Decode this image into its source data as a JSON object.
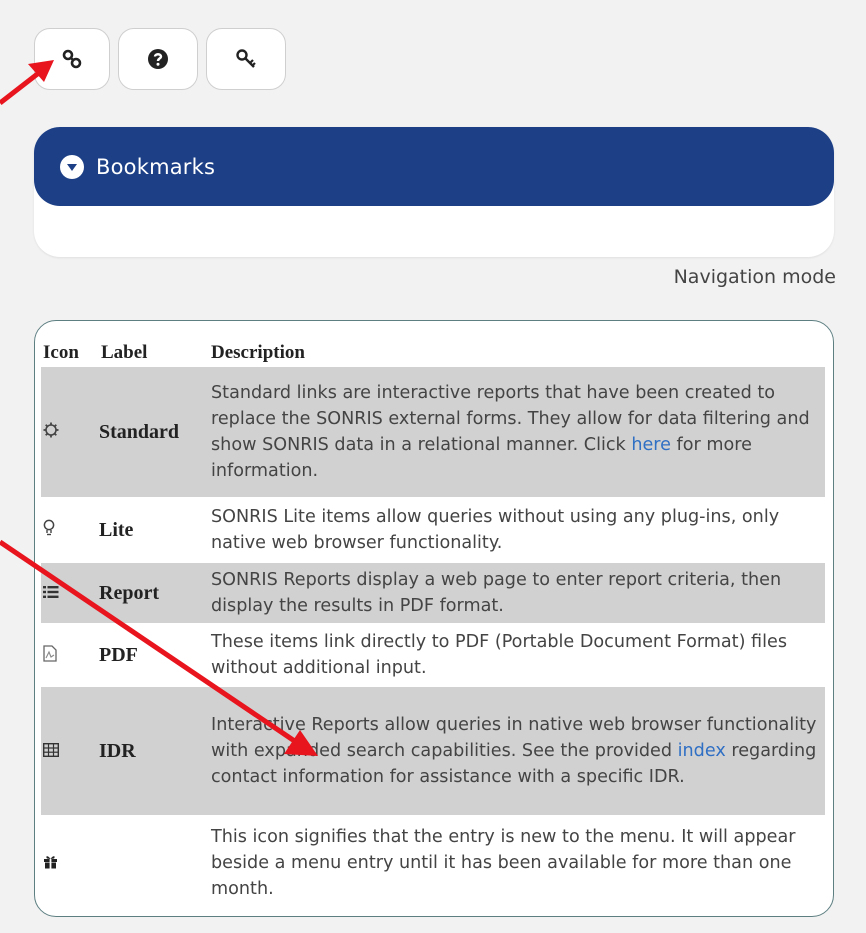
{
  "toolbar": {
    "buttons": [
      {
        "icon": "link-icon"
      },
      {
        "icon": "question-circle-icon"
      },
      {
        "icon": "key-icon"
      }
    ]
  },
  "panel": {
    "title": "Bookmarks",
    "toggle_icon": "chevron-down-circle-icon",
    "header_color": "#1c3f86"
  },
  "nav_mode_label": "Navigation mode",
  "legend": {
    "headers": {
      "icon": "Icon",
      "label": "Label",
      "description": "Description"
    },
    "rows": [
      {
        "icon": "gear-icon",
        "label": "Standard",
        "desc_before": "Standard links are interactive reports that have been created to replace the SONRIS external forms. They allow for data filtering and show SONRIS data in a relational manner. Click ",
        "link_text": "here",
        "desc_after": " for more information."
      },
      {
        "icon": "lightbulb-icon",
        "label": "Lite",
        "description": "SONRIS Lite items allow queries without using any plug-ins, only native web browser functionality."
      },
      {
        "icon": "list-icon",
        "label": "Report",
        "description": "SONRIS Reports display a web page to enter report criteria, then display the results in PDF format."
      },
      {
        "icon": "pdf-file-icon",
        "label": "PDF",
        "description": "These items link directly to PDF (Portable Document Format) files without additional input."
      },
      {
        "icon": "table-icon",
        "label": "IDR",
        "desc_before": "Interactive Reports allow queries in native web browser functionality with expanded search capabilities. See the provided ",
        "link_text": "index",
        "desc_after": " regarding contact information for assistance with a specific IDR."
      },
      {
        "icon": "gift-icon",
        "label": "",
        "description": "This icon signifies that the entry is new to the menu. It will appear beside a menu entry until it has been available for more than one month."
      }
    ]
  },
  "colors": {
    "link": "#2f6fc4",
    "annotation_arrow": "#e8141e",
    "row_shade": "#d1d1d1"
  }
}
